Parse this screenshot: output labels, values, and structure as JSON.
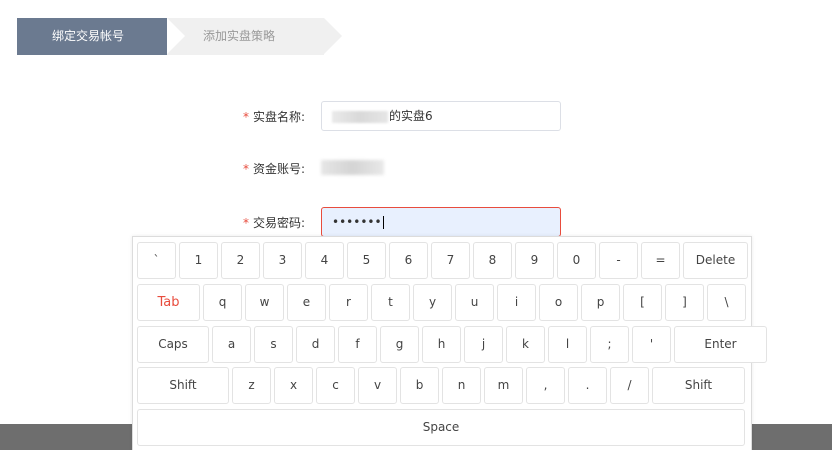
{
  "steps": [
    {
      "label": "绑定交易帐号"
    },
    {
      "label": "添加实盘策略"
    }
  ],
  "form": {
    "name": {
      "required": "*",
      "label": "实盘名称:",
      "value_suffix": "的实盘6"
    },
    "account": {
      "required": "*",
      "label": "资金账号:"
    },
    "password": {
      "required": "*",
      "label": "交易密码:",
      "value": "•••••••"
    }
  },
  "keyboard": {
    "rows": [
      [
        "`",
        "1",
        "2",
        "3",
        "4",
        "5",
        "6",
        "7",
        "8",
        "9",
        "0",
        "-",
        "=",
        "Delete"
      ],
      [
        "Tab",
        "q",
        "w",
        "e",
        "r",
        "t",
        "y",
        "u",
        "i",
        "o",
        "p",
        "[",
        "]",
        "\\"
      ],
      [
        "Caps",
        "a",
        "s",
        "d",
        "f",
        "g",
        "h",
        "j",
        "k",
        "l",
        ";",
        "'",
        "Enter"
      ],
      [
        "Shift",
        "z",
        "x",
        "c",
        "v",
        "b",
        "n",
        "m",
        ",",
        ".",
        "/",
        "Shift"
      ],
      [
        "Space"
      ]
    ]
  }
}
